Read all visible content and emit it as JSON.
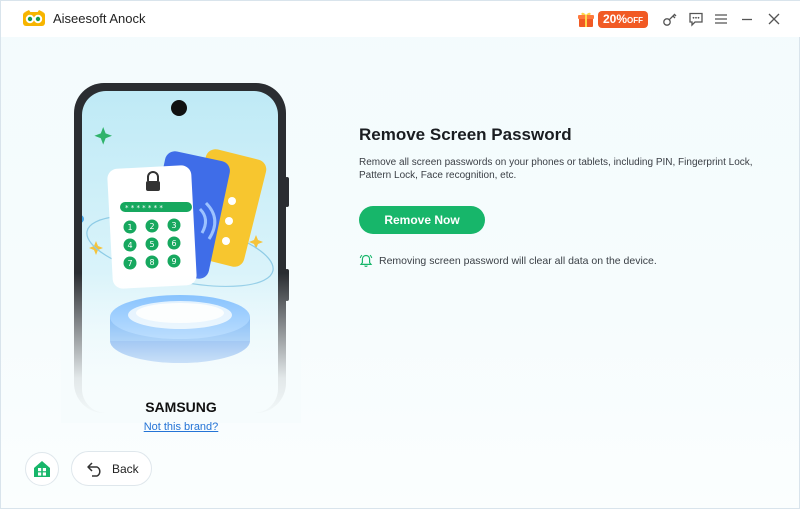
{
  "window": {
    "title": "Aiseesoft Anock",
    "promo": {
      "percent": "20%",
      "suffix": "OFF"
    }
  },
  "main": {
    "heading": "Remove Screen Password",
    "description": "Remove all screen passwords on your phones or tablets, including PIN, Fingerprint Lock, Pattern Lock, Face recognition, etc.",
    "action_label": "Remove Now",
    "warning": "Removing screen password will clear all data on the device."
  },
  "device": {
    "brand": "SAMSUNG",
    "brand_link": "Not this brand?",
    "keypad_digits": [
      "1",
      "2",
      "3",
      "4",
      "5",
      "6",
      "7",
      "8",
      "9"
    ]
  },
  "nav": {
    "back_label": "Back"
  },
  "colors": {
    "accent_green": "#17b66a",
    "promo_orange": "#f15a24",
    "link_blue": "#2474d6"
  },
  "icons": {
    "titlebar": [
      "gift-icon",
      "key-icon",
      "feedback-icon",
      "menu-icon",
      "minimize-icon",
      "close-icon"
    ],
    "bottom": [
      "home-icon",
      "back-arrow-icon"
    ]
  }
}
